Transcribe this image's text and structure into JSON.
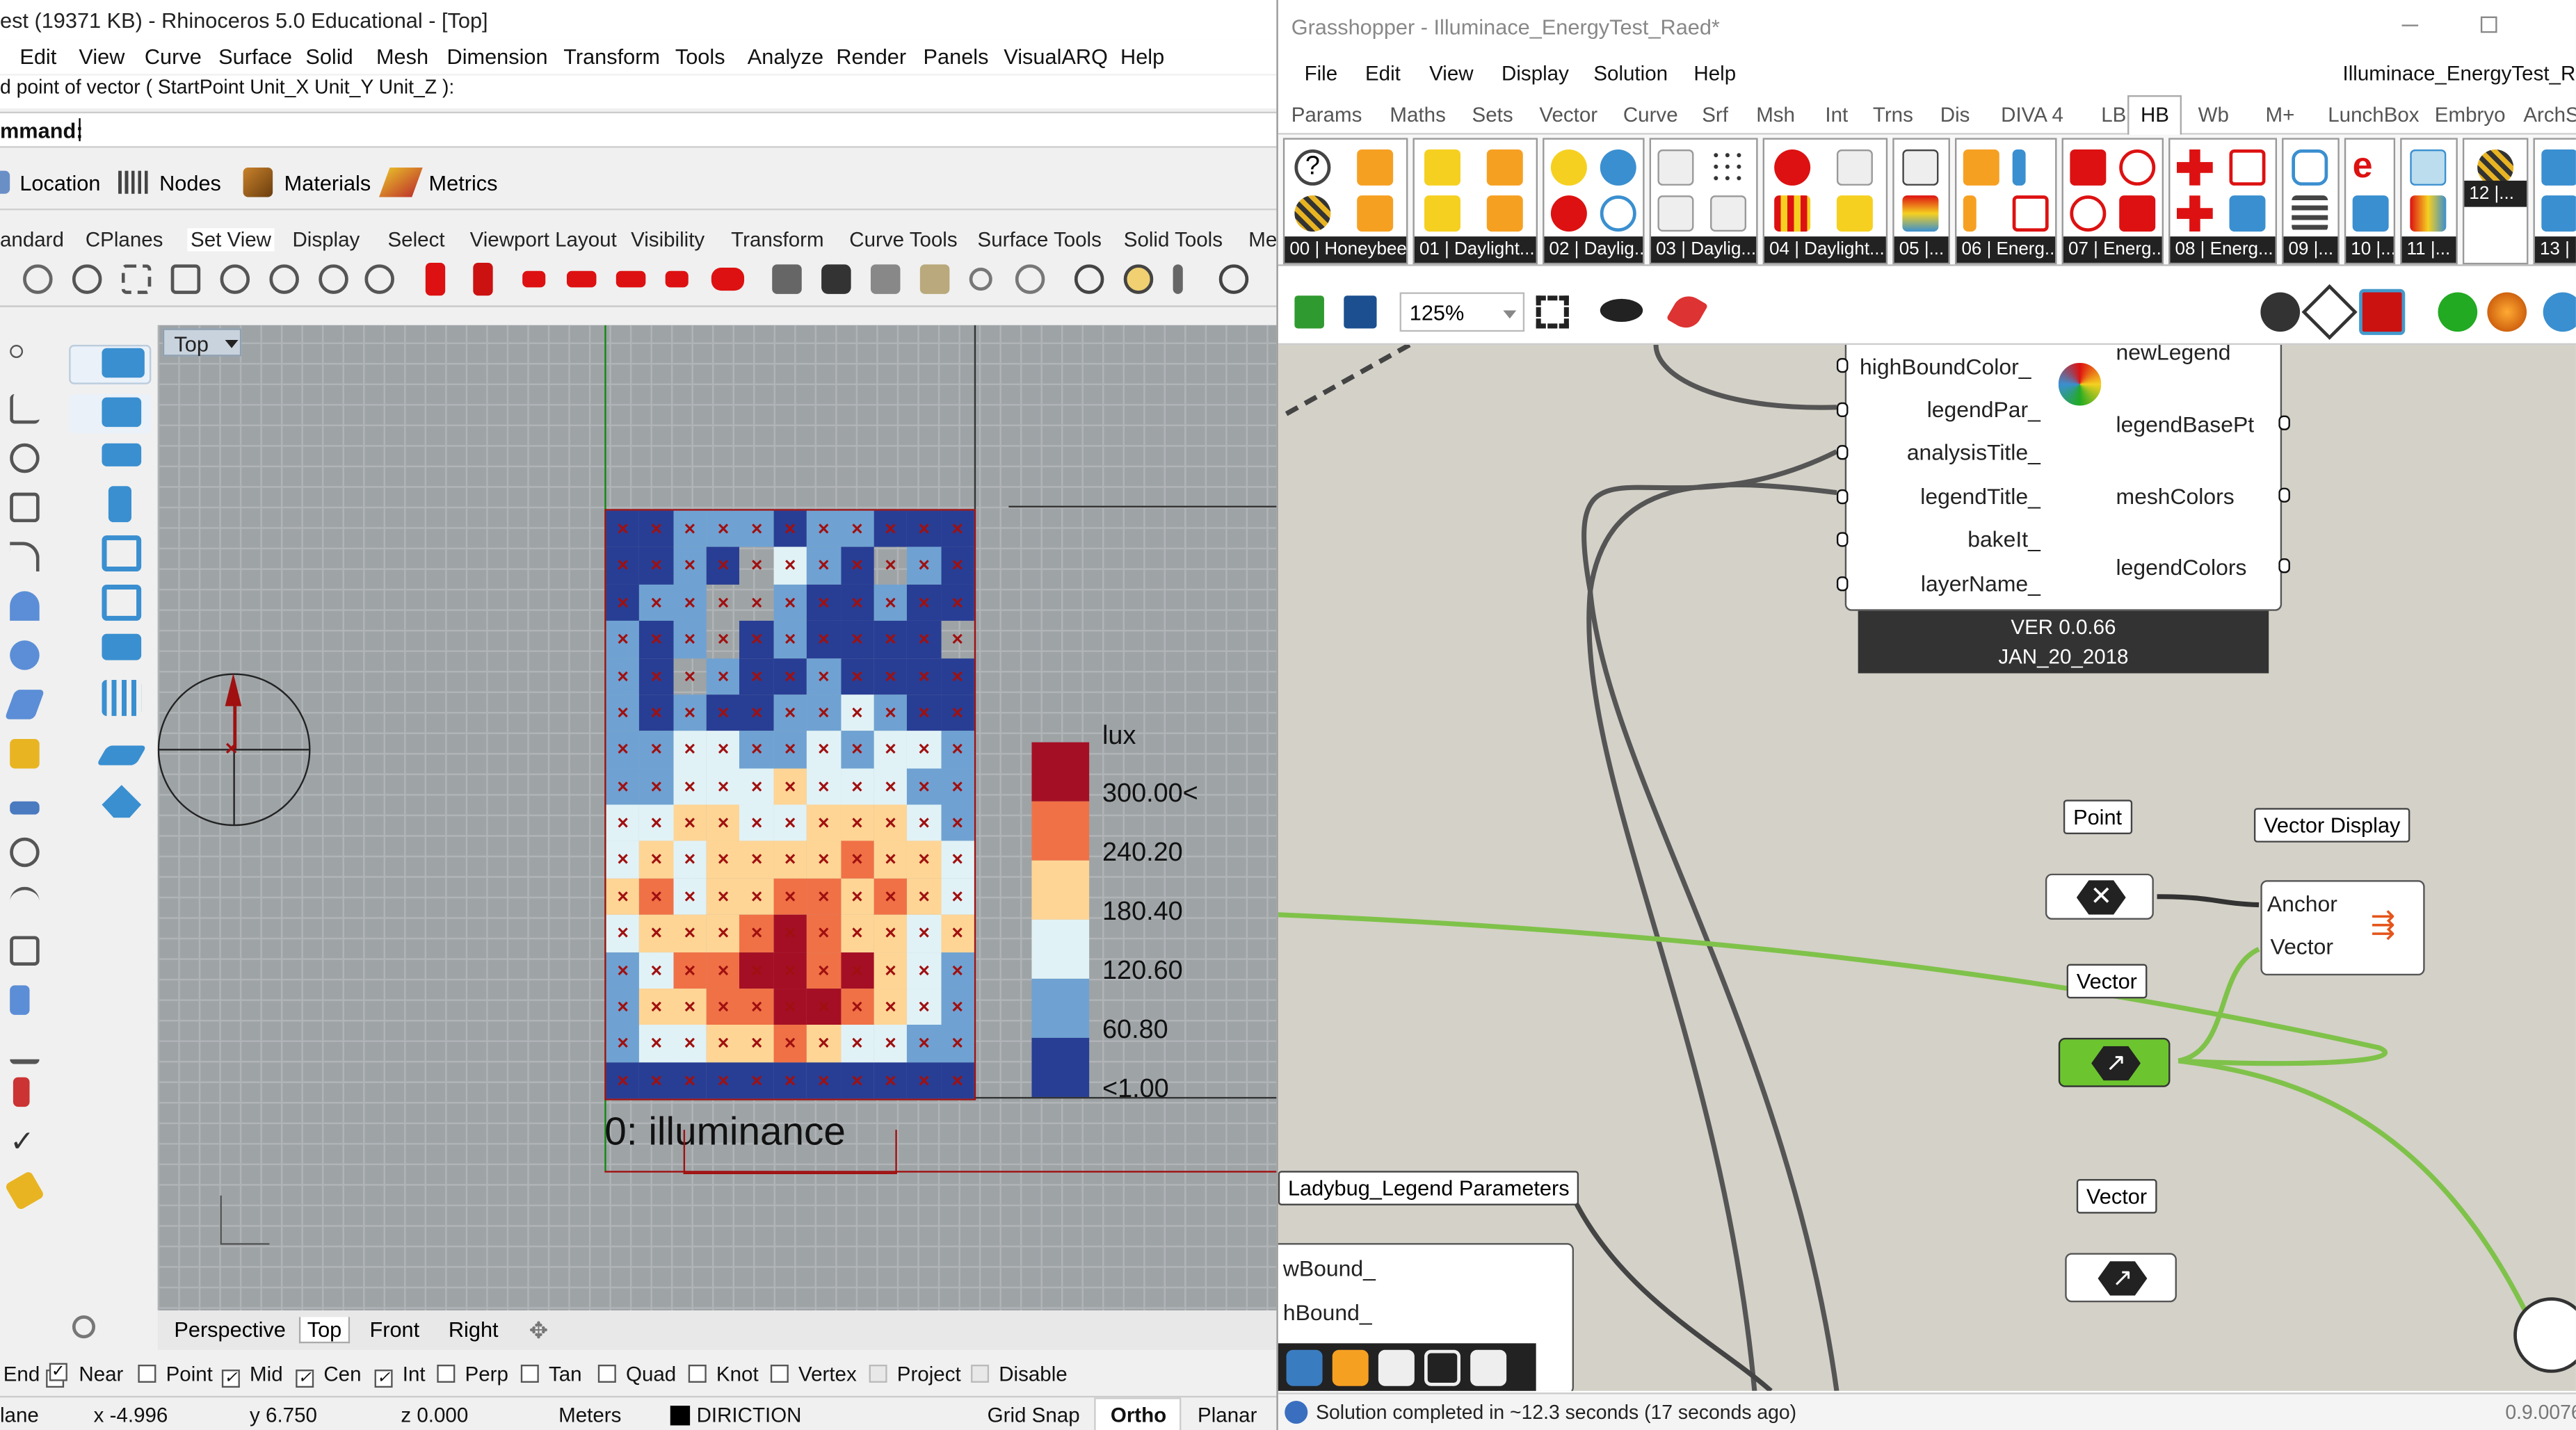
{
  "rhino": {
    "title": "est (19371 KB) - Rhinoceros 5.0 Educational - [Top]",
    "menu": [
      "Edit",
      "View",
      "Curve",
      "Surface",
      "Solid",
      "Mesh",
      "Dimension",
      "Transform",
      "Tools",
      "Analyze",
      "Render",
      "Panels",
      "VisualARQ",
      "Help"
    ],
    "command_history": "d point of vector ( StartPoint  Unit_X  Unit_Y  Unit_Z ):",
    "command_label": "mmand:",
    "visualarq": {
      "location": "Location",
      "nodes": "Nodes",
      "materials": "Materials",
      "metrics": "Metrics"
    },
    "toolbar_tabs": [
      "andard",
      "CPlanes",
      "Set View",
      "Display",
      "Select",
      "Viewport Layout",
      "Visibility",
      "Transform",
      "Curve Tools",
      "Surface Tools",
      "Solid Tools",
      "Me"
    ],
    "viewport": {
      "name": "Top",
      "caption": "0: illuminance"
    },
    "legend": {
      "unit": "lux",
      "values": [
        "300.00<",
        "240.20",
        "180.40",
        "120.60",
        "60.80",
        "<1.00"
      ],
      "colors": [
        "#a50f25",
        "#f07146",
        "#fed595",
        "#e1f2f6",
        "#6fa2d2",
        "#283e94"
      ]
    },
    "grid": {
      "rows": 16,
      "cols": 11,
      "cells": [
        "55444544555",
        "55456345645",
        "54466455455",
        "45465455556",
        "45645545555",
        "45455443455",
        "44334434334",
        "44333233344",
        "33223322234",
        "32322221223",
        "21322112123",
        "32221012232",
        "43110010234",
        "42211001234",
        "43322123344",
        "55555555555"
      ]
    },
    "view_tabs": [
      "Perspective",
      "Top",
      "Front",
      "Right"
    ],
    "osnaps": [
      {
        "label": "End",
        "checked": true
      },
      {
        "label": "Near",
        "checked": true
      },
      {
        "label": "Point",
        "checked": false
      },
      {
        "label": "Mid",
        "checked": true
      },
      {
        "label": "Cen",
        "checked": true
      },
      {
        "label": "Int",
        "checked": true
      },
      {
        "label": "Perp",
        "checked": false
      },
      {
        "label": "Tan",
        "checked": false
      },
      {
        "label": "Quad",
        "checked": false
      },
      {
        "label": "Knot",
        "checked": false
      },
      {
        "label": "Vertex",
        "checked": false
      },
      {
        "label": "Project",
        "checked": false
      },
      {
        "label": "Disable",
        "checked": false
      }
    ],
    "status": {
      "plane": "lane",
      "x": "x -4.996",
      "y": "y 6.750",
      "z": "z 0.000",
      "units": "Meters",
      "layer": "DIRICTION",
      "snap": "Grid Snap",
      "ortho": "Ortho",
      "planar": "Planar"
    }
  },
  "gh": {
    "title": "Grasshopper - Illuminace_EnergyTest_Raed*",
    "doc_name": "Illuminace_EnergyTest_Rae",
    "menu": [
      "File",
      "Edit",
      "View",
      "Display",
      "Solution",
      "Help"
    ],
    "tabs": [
      "Params",
      "Maths",
      "Sets",
      "Vector",
      "Curve",
      "Srf",
      "Msh",
      "Int",
      "Trns",
      "Dis",
      "DIVA 4",
      "LB",
      "HB",
      "Wb",
      "M+",
      "LunchBox",
      "Embryo",
      "ArchS"
    ],
    "active_tab": "HB",
    "groups": [
      "00 | Honeybee",
      "01 | Daylight...",
      "02 | Daylig...",
      "03 | Daylig...",
      "04 | Daylight...",
      "05 |...",
      "06 | Energ...",
      "07 | Energ...",
      "08 | Energ...",
      "09 |...",
      "10 |...",
      "11 |...",
      "12 |...",
      "13 |"
    ],
    "zoom": "125%",
    "component": {
      "inputs": [
        "highBoundColor_",
        "legendPar_",
        "analysisTitle_",
        "legendTitle_",
        "bakeIt_",
        "layerName_"
      ],
      "outputs": [
        "newLegend",
        "legendBasePt",
        "meshColors",
        "legendColors"
      ],
      "version": "VER 0.0.66",
      "date": "JAN_20_2018"
    },
    "point_label": "Point",
    "vector_label": "Vector",
    "vector_label2": "Vector",
    "vector_display": {
      "title": "Vector Display",
      "in1": "Anchor",
      "in2": "Vector"
    },
    "legend_params": {
      "title": "Ladybug_Legend Parameters",
      "in1": "wBound_",
      "in2": "hBound_"
    },
    "status": "Solution completed in ~12.3 seconds (17 seconds ago)",
    "version": "0.9.0076"
  }
}
